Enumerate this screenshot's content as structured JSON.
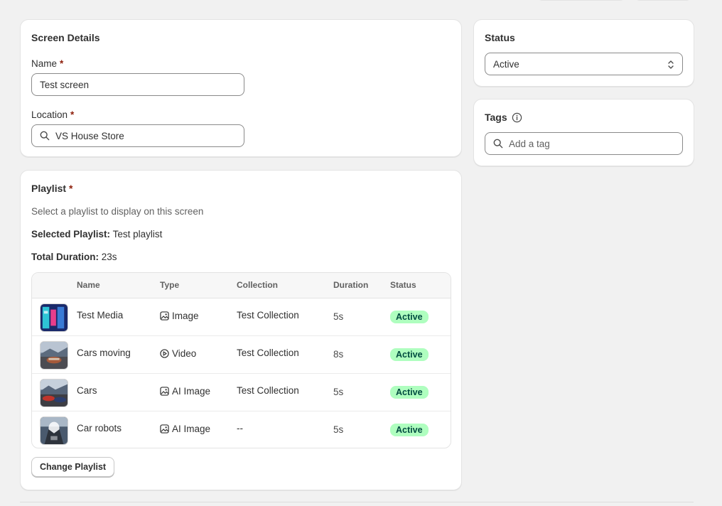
{
  "screen_details": {
    "title": "Screen Details",
    "name_label": "Name",
    "name_value": "Test screen",
    "location_label": "Location",
    "location_value": "VS House Store",
    "required_mark": "*"
  },
  "status_card": {
    "title": "Status",
    "selected": "Active"
  },
  "tags_card": {
    "title": "Tags",
    "placeholder": "Add a tag"
  },
  "playlist": {
    "title": "Playlist",
    "required_mark": "*",
    "description": "Select a playlist to display on this screen",
    "selected_label": "Selected Playlist:",
    "selected_value": "Test playlist",
    "duration_label": "Total Duration:",
    "duration_value": "23s",
    "columns": [
      "Name",
      "Type",
      "Collection",
      "Duration",
      "Status"
    ],
    "rows": [
      {
        "name": "Test Media",
        "type": "Image",
        "type_icon": "image-icon",
        "collection": "Test Collection",
        "duration": "5s",
        "status": "Active"
      },
      {
        "name": "Cars moving",
        "type": "Video",
        "type_icon": "play-circle-icon",
        "collection": "Test Collection",
        "duration": "8s",
        "status": "Active"
      },
      {
        "name": "Cars",
        "type": "AI Image",
        "type_icon": "image-icon",
        "collection": "Test Collection",
        "duration": "5s",
        "status": "Active"
      },
      {
        "name": "Car robots",
        "type": "AI Image",
        "type_icon": "image-icon",
        "collection": "--",
        "duration": "5s",
        "status": "Active"
      }
    ],
    "change_button": "Change Playlist"
  },
  "colors": {
    "background": "#f1f1f1",
    "card": "#ffffff",
    "required": "#8e1f0b",
    "badge_bg": "#affebf",
    "badge_text": "#014b40"
  }
}
